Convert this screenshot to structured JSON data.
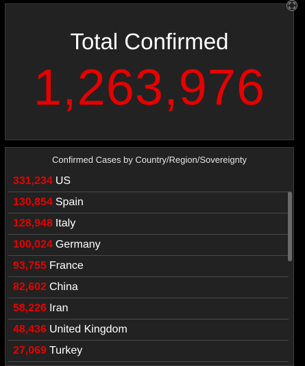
{
  "total": {
    "title": "Total Confirmed",
    "value": "1,263,976"
  },
  "list": {
    "title": "Confirmed Cases by Country/Region/Sovereignty",
    "items": [
      {
        "num": "331,234",
        "label": "US"
      },
      {
        "num": "130,854",
        "label": "Spain"
      },
      {
        "num": "128,948",
        "label": "Italy"
      },
      {
        "num": "100,024",
        "label": "Germany"
      },
      {
        "num": "93,755",
        "label": "France"
      },
      {
        "num": "82,602",
        "label": "China"
      },
      {
        "num": "58,226",
        "label": "Iran"
      },
      {
        "num": "48,436",
        "label": "United Kingdom"
      },
      {
        "num": "27,069",
        "label": "Turkey"
      }
    ]
  },
  "colors": {
    "accent": "#e60000",
    "panel_bg": "#222222",
    "page_bg": "#000000"
  }
}
